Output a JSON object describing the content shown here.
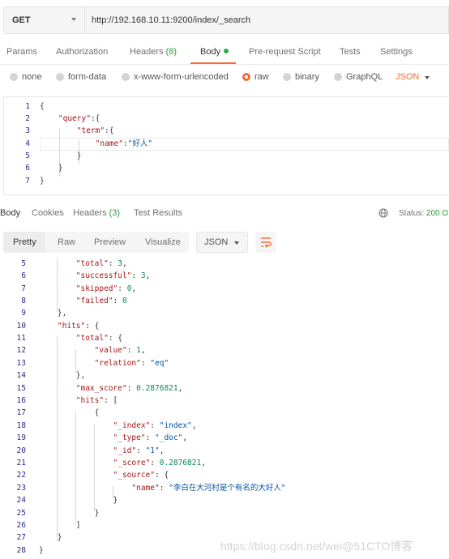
{
  "request": {
    "method": "GET",
    "url": "http://192.168.10.11:9200/index/_search"
  },
  "request_tabs": {
    "params": "Params",
    "authorization": "Authorization",
    "headers_label": "Headers",
    "headers_count": "(8)",
    "body": "Body",
    "prerequest": "Pre-request Script",
    "tests": "Tests",
    "settings": "Settings"
  },
  "body_options": {
    "none": "none",
    "form_data": "form-data",
    "urlencoded": "x-www-form-urlencoded",
    "raw": "raw",
    "binary": "binary",
    "graphql": "GraphQL",
    "format": "JSON"
  },
  "request_editor": {
    "line_numbers": [
      "1",
      "2",
      "3",
      "4",
      "5",
      "6",
      "7"
    ]
  },
  "response_tabs": {
    "body": "Body",
    "cookies": "Cookies",
    "headers_label": "Headers",
    "headers_count": "(3)",
    "test_results": "Test Results",
    "status_label": "Status:",
    "status_value": "200 O"
  },
  "response_toolbar": {
    "pretty": "Pretty",
    "raw": "Raw",
    "preview": "Preview",
    "visualize": "Visualize",
    "format": "JSON"
  },
  "response_editor": {
    "line_numbers": [
      "5",
      "6",
      "7",
      "8",
      "9",
      "10",
      "11",
      "12",
      "13",
      "14",
      "15",
      "16",
      "17",
      "18",
      "19",
      "20",
      "21",
      "22",
      "23",
      "24",
      "25",
      "26",
      "27",
      "28"
    ]
  },
  "watermark": "https://blog.csdn.net/wei@51CTO博客",
  "colors": {
    "accent": "#f26b3a",
    "success": "#26b047",
    "key": "#a31515",
    "string": "#0451a5",
    "number": "#098658"
  }
}
